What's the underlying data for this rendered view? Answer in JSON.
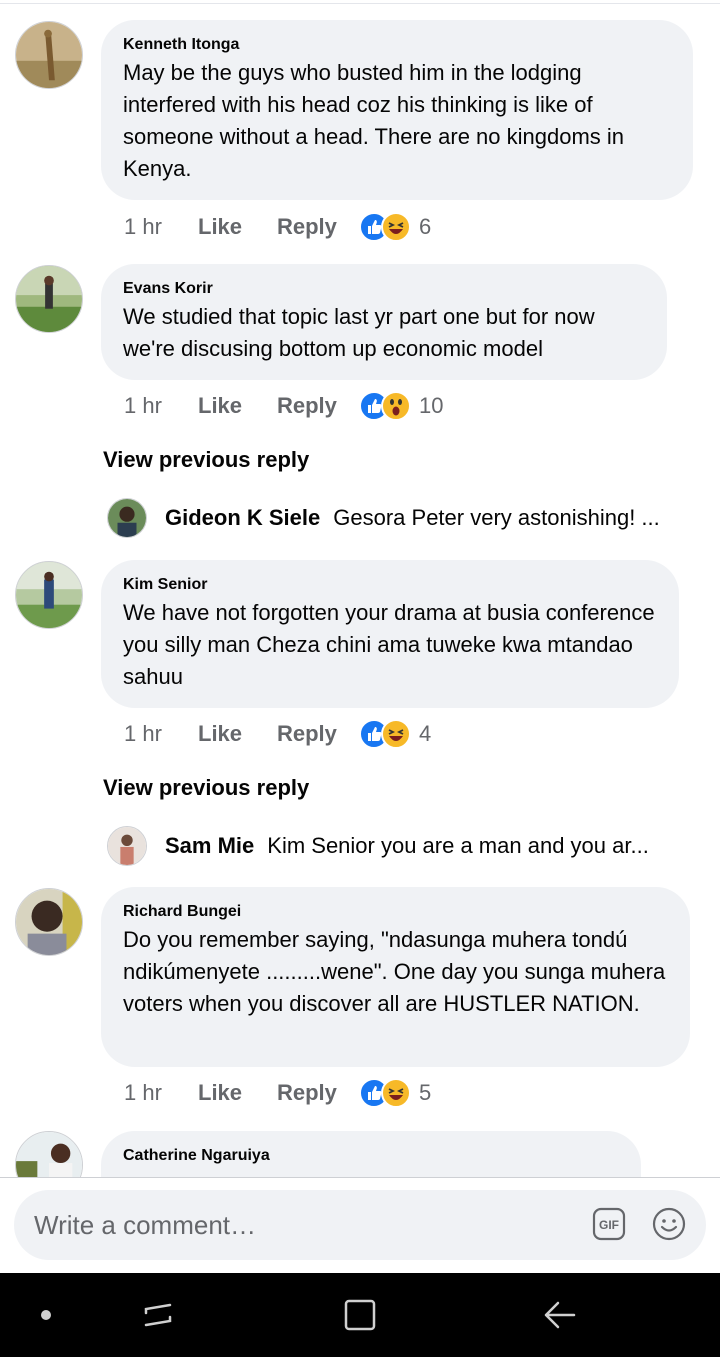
{
  "comments": [
    {
      "author": "Kenneth Itonga",
      "text": "May be the guys who busted him in the lodging interfered with his head coz his thinking is like of someone without a head. There are no kingdoms in Kenya.",
      "time": "1 hr",
      "like": "Like",
      "reply": "Reply",
      "reaction_count": "6",
      "reactions": [
        "like-icon",
        "haha-icon"
      ]
    },
    {
      "author": "Evans Korir",
      "text": "We studied that topic last yr part one but for now we're discusing bottom up economic model",
      "time": "1 hr",
      "like": "Like",
      "reply": "Reply",
      "reaction_count": "10",
      "reactions": [
        "like-icon",
        "wow-icon"
      ]
    },
    {
      "author": "Kim Senior",
      "text": "We have not forgotten your drama at busia conference you silly man Cheza chini ama tuweke kwa mtandao sahuu",
      "time": "1 hr",
      "like": "Like",
      "reply": "Reply",
      "reaction_count": "4",
      "reactions": [
        "like-icon",
        "haha-icon"
      ]
    },
    {
      "author": "Richard Bungei",
      "text": "Do you remember saying, \"ndasunga muhera tondú ndikúmenyete .........wene\". One day you sunga muhera voters when you discover all are HUSTLER NATION.",
      "time": "1 hr",
      "like": "Like",
      "reply": "Reply",
      "reaction_count": "5",
      "reactions": [
        "like-icon",
        "haha-icon"
      ]
    },
    {
      "author": "Catherine Ngaruiya"
    }
  ],
  "reply_previews": [
    {
      "view_previous": "View previous reply",
      "author": "Gideon K Siele",
      "text": "Gesora Peter very astonishing! ..."
    },
    {
      "view_previous": "View previous reply",
      "author": "Sam Mie",
      "text": "Kim Senior you are a man and you ar..."
    }
  ],
  "composer": {
    "placeholder": "Write a comment…",
    "gif_label": "GIF"
  },
  "colors": {
    "like_blue": "#1877f2",
    "haha_yellow": "#f7b928",
    "bubble_bg": "#f0f2f5",
    "meta_gray": "#65676b"
  }
}
